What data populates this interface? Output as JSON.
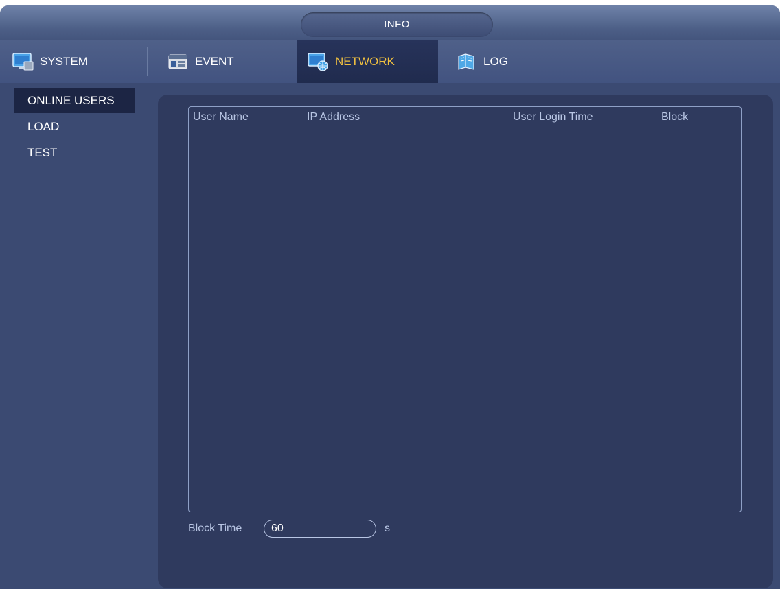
{
  "window": {
    "title": "INFO"
  },
  "tabs": [
    {
      "label": "SYSTEM",
      "icon": "system-monitor-icon",
      "active": false
    },
    {
      "label": "EVENT",
      "icon": "event-icon",
      "active": false
    },
    {
      "label": "NETWORK",
      "icon": "network-icon",
      "active": true
    },
    {
      "label": "LOG",
      "icon": "log-book-icon",
      "active": false
    }
  ],
  "sidebar": {
    "items": [
      {
        "label": "ONLINE USERS",
        "active": true
      },
      {
        "label": "LOAD",
        "active": false
      },
      {
        "label": "TEST",
        "active": false
      }
    ]
  },
  "table": {
    "columns": [
      "User Name",
      "IP Address",
      "User Login Time",
      "Block"
    ],
    "rows": []
  },
  "block_time": {
    "label": "Block Time",
    "value": "60",
    "unit": "s"
  },
  "colors": {
    "background": "#3b4a72",
    "panel": "#2f3a5e",
    "active_tab_text": "#f0c040"
  }
}
